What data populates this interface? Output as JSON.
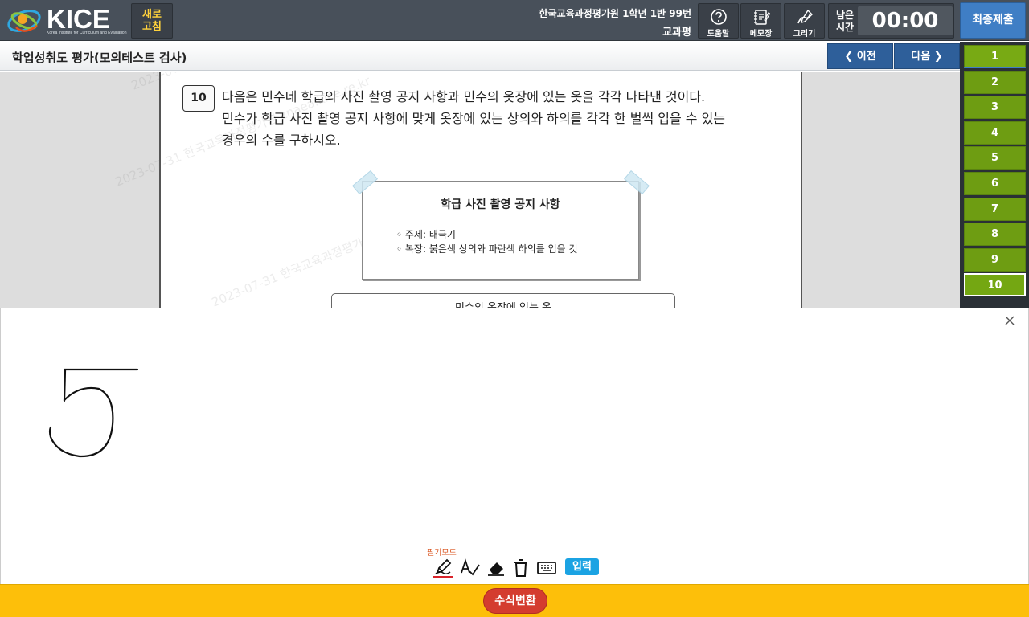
{
  "header": {
    "logo_text": "KICE",
    "logo_subtitle": "Korea Institute for Curriculum and Evaluation",
    "refresh_label": "새로\n고침",
    "exam_line1": "한국교육과정평가원 1학년 1반 99번",
    "exam_line2": "교과평",
    "tools": [
      {
        "label": "도움말",
        "icon": "help-icon"
      },
      {
        "label": "메모장",
        "icon": "notepad-icon"
      },
      {
        "label": "그리기",
        "icon": "draw-icon"
      }
    ],
    "timer_label": "남은\n시간",
    "timer_value": "00:00",
    "submit_label": "최종제출"
  },
  "titlebar": {
    "title": "학업성취도 평가(모의테스트 검사)",
    "prev_label": "❮ 이전",
    "next_label": "다음 ❯"
  },
  "question_nav": {
    "items": [
      "1",
      "2",
      "3",
      "4",
      "5",
      "6",
      "7",
      "8",
      "9",
      "10"
    ],
    "active": "10"
  },
  "question": {
    "number": "10",
    "text_line1": "다음은 민수네 학급의 사진 촬영 공지 사항과 민수의 옷장에 있는 옷을 각각 나타낸 것이다.",
    "text_line2": "민수가 학급 사진 촬영 공지 사항에 맞게 옷장에 있는 상의와 하의를 각각 한 벌씩 입을 수 있는",
    "text_line3": "경우의 수를 구하시오.",
    "notice_title": "학급 사진 촬영 공지 사항",
    "notice_item1": "◦ 주제: 태극기",
    "notice_item2": "◦ 복장: 붉은색 상의와 파란색 하의를 입을 것",
    "closet_title": "민수의 옷장에 있는 옷"
  },
  "watermark": "2023-07-31 한국교육과정평가원 znaea.kice.re.kr",
  "drawing_panel": {
    "mode_label": "필기모드",
    "tools": [
      "pen-icon",
      "handwriting-recognize-icon",
      "eraser-icon",
      "trash-icon",
      "keyboard-icon"
    ],
    "input_label": "입력",
    "handwritten_value": "5"
  },
  "bottom_bar": {
    "convert_label": "수식변환"
  },
  "colors": {
    "header_bg": "#48505a",
    "nav_blue": "#2e5f9a",
    "qnav_green": "#6e9d12",
    "bottom_yellow": "#fdbf0a",
    "convert_red": "#d43c2f",
    "input_blue": "#1ba3e3",
    "submit_blue": "#3f7ec5",
    "refresh_text": "#ffd23c"
  }
}
